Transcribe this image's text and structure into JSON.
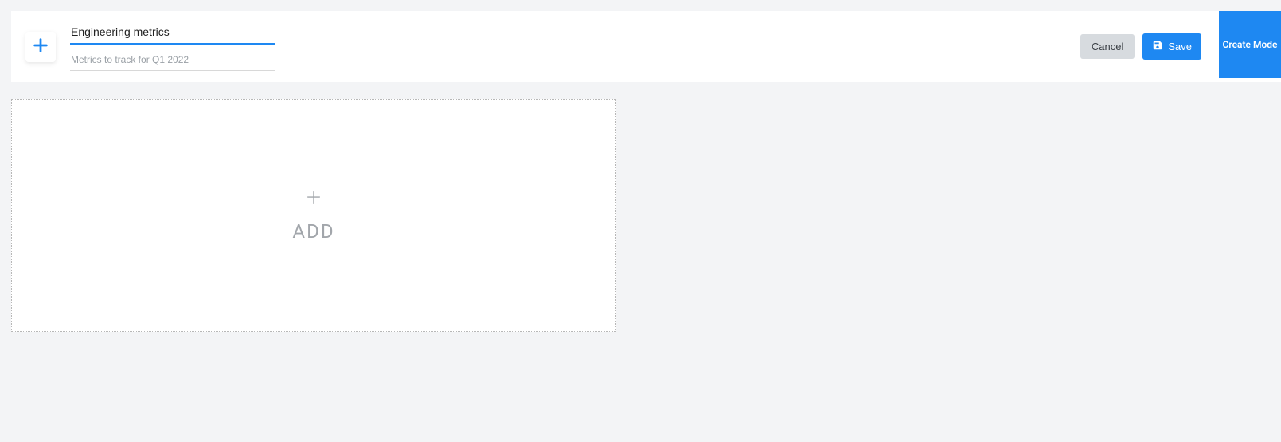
{
  "header": {
    "title_value": "Engineering metrics",
    "subtitle_value": "Metrics to track for Q1 2022",
    "cancel_label": "Cancel",
    "save_label": "Save",
    "create_mode_label": "Create Mode"
  },
  "panel": {
    "add_label": "ADD"
  },
  "colors": {
    "accent": "#1e88f2",
    "muted": "#a2a6ab",
    "cancel_bg": "#d7dbdf"
  }
}
